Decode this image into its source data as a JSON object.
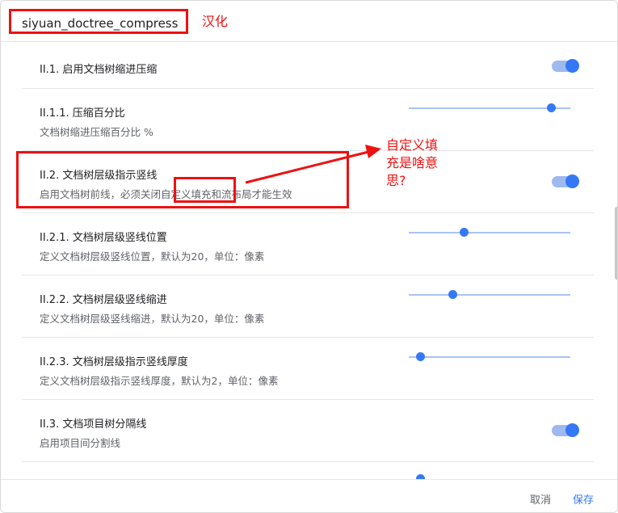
{
  "dialog": {
    "title": "siyuan_doctree_compress",
    "cancel_label": "取消",
    "save_label": "保存"
  },
  "settings": [
    {
      "title": "II.1. 启用文档树缩进压缩",
      "description": "",
      "control": "toggle",
      "checked": true
    },
    {
      "title": "II.1.1. 压缩百分比",
      "description": "文档树缩进压缩百分比 %",
      "control": "slider",
      "level": 0.88
    },
    {
      "title": "II.2. 文档树层级指示竖线",
      "description": "启用文档树前线，必须关闭自定义填充和流布局才能生效",
      "control": "toggle",
      "checked": true
    },
    {
      "title": "II.2.1. 文档树层级竖线位置",
      "description": "定义文档树层级竖线位置，默认为20，单位：像素",
      "control": "slider",
      "level": 0.34
    },
    {
      "title": "II.2.2. 文档树层级竖线缩进",
      "description": "定义文档树层级竖线缩进，默认为20，单位：像素",
      "control": "slider",
      "level": 0.27
    },
    {
      "title": "II.2.3. 文档树层级指示竖线厚度",
      "description": "定义文档树层级指示竖线厚度，默认为2，单位：像素",
      "control": "slider",
      "level": 0.07
    },
    {
      "title": "II.3. 文档项目树分隔线",
      "description": "启用项目间分割线",
      "control": "toggle",
      "checked": true
    }
  ],
  "annotations": {
    "title_note": "汉化",
    "question": [
      "自定义填",
      "充是啥意",
      "思?"
    ],
    "color": "#ee1111"
  },
  "colors": {
    "accent": "#3478f6",
    "accent_light": "#a8c3f4"
  }
}
